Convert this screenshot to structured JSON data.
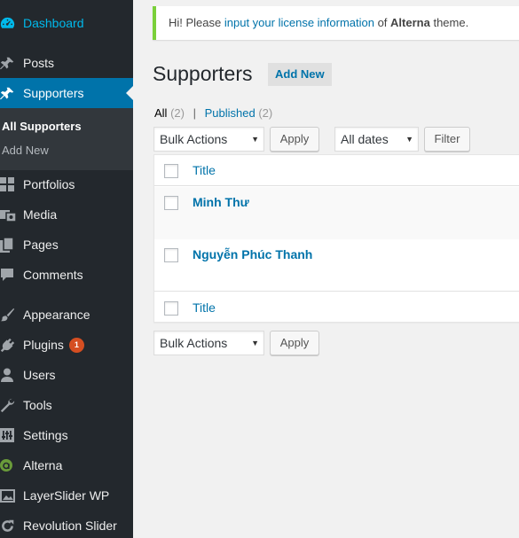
{
  "sidebar": {
    "items": [
      {
        "key": "dashboard",
        "label": "Dashboard"
      },
      {
        "key": "posts",
        "label": "Posts"
      },
      {
        "key": "supporters",
        "label": "Supporters"
      },
      {
        "key": "portfolios",
        "label": "Portfolios"
      },
      {
        "key": "media",
        "label": "Media"
      },
      {
        "key": "pages",
        "label": "Pages"
      },
      {
        "key": "comments",
        "label": "Comments"
      },
      {
        "key": "appearance",
        "label": "Appearance"
      },
      {
        "key": "plugins",
        "label": "Plugins",
        "badge": "1"
      },
      {
        "key": "users",
        "label": "Users"
      },
      {
        "key": "tools",
        "label": "Tools"
      },
      {
        "key": "settings",
        "label": "Settings"
      },
      {
        "key": "alterna",
        "label": "Alterna"
      },
      {
        "key": "layerslider",
        "label": "LayerSlider WP"
      },
      {
        "key": "revslider",
        "label": "Revolution Slider"
      }
    ],
    "submenu": [
      {
        "label": "All Supporters"
      },
      {
        "label": "Add New"
      }
    ]
  },
  "notice": {
    "prefix": "Hi! Please ",
    "link": "input your license information",
    "middle": " of ",
    "theme": "Alterna",
    "suffix": " theme."
  },
  "page": {
    "title": "Supporters",
    "add_new": "Add New"
  },
  "filters": {
    "all_label": "All",
    "all_count": "(2)",
    "separator": "|",
    "published_label": "Published",
    "published_count": "(2)"
  },
  "bulk_top": {
    "selected": "Bulk Actions",
    "apply": "Apply"
  },
  "dates": {
    "selected": "All dates",
    "filter": "Filter"
  },
  "bulk_bottom": {
    "selected": "Bulk Actions",
    "apply": "Apply"
  },
  "table": {
    "column_title": "Title",
    "rows": [
      {
        "title": "Minh Thư"
      },
      {
        "title": "Nguyễn Phúc Thanh"
      }
    ]
  },
  "colors": {
    "sidebar_bg": "#23282d",
    "accent": "#0073aa",
    "notice_border": "#7ad03a",
    "badge": "#d54e21"
  }
}
